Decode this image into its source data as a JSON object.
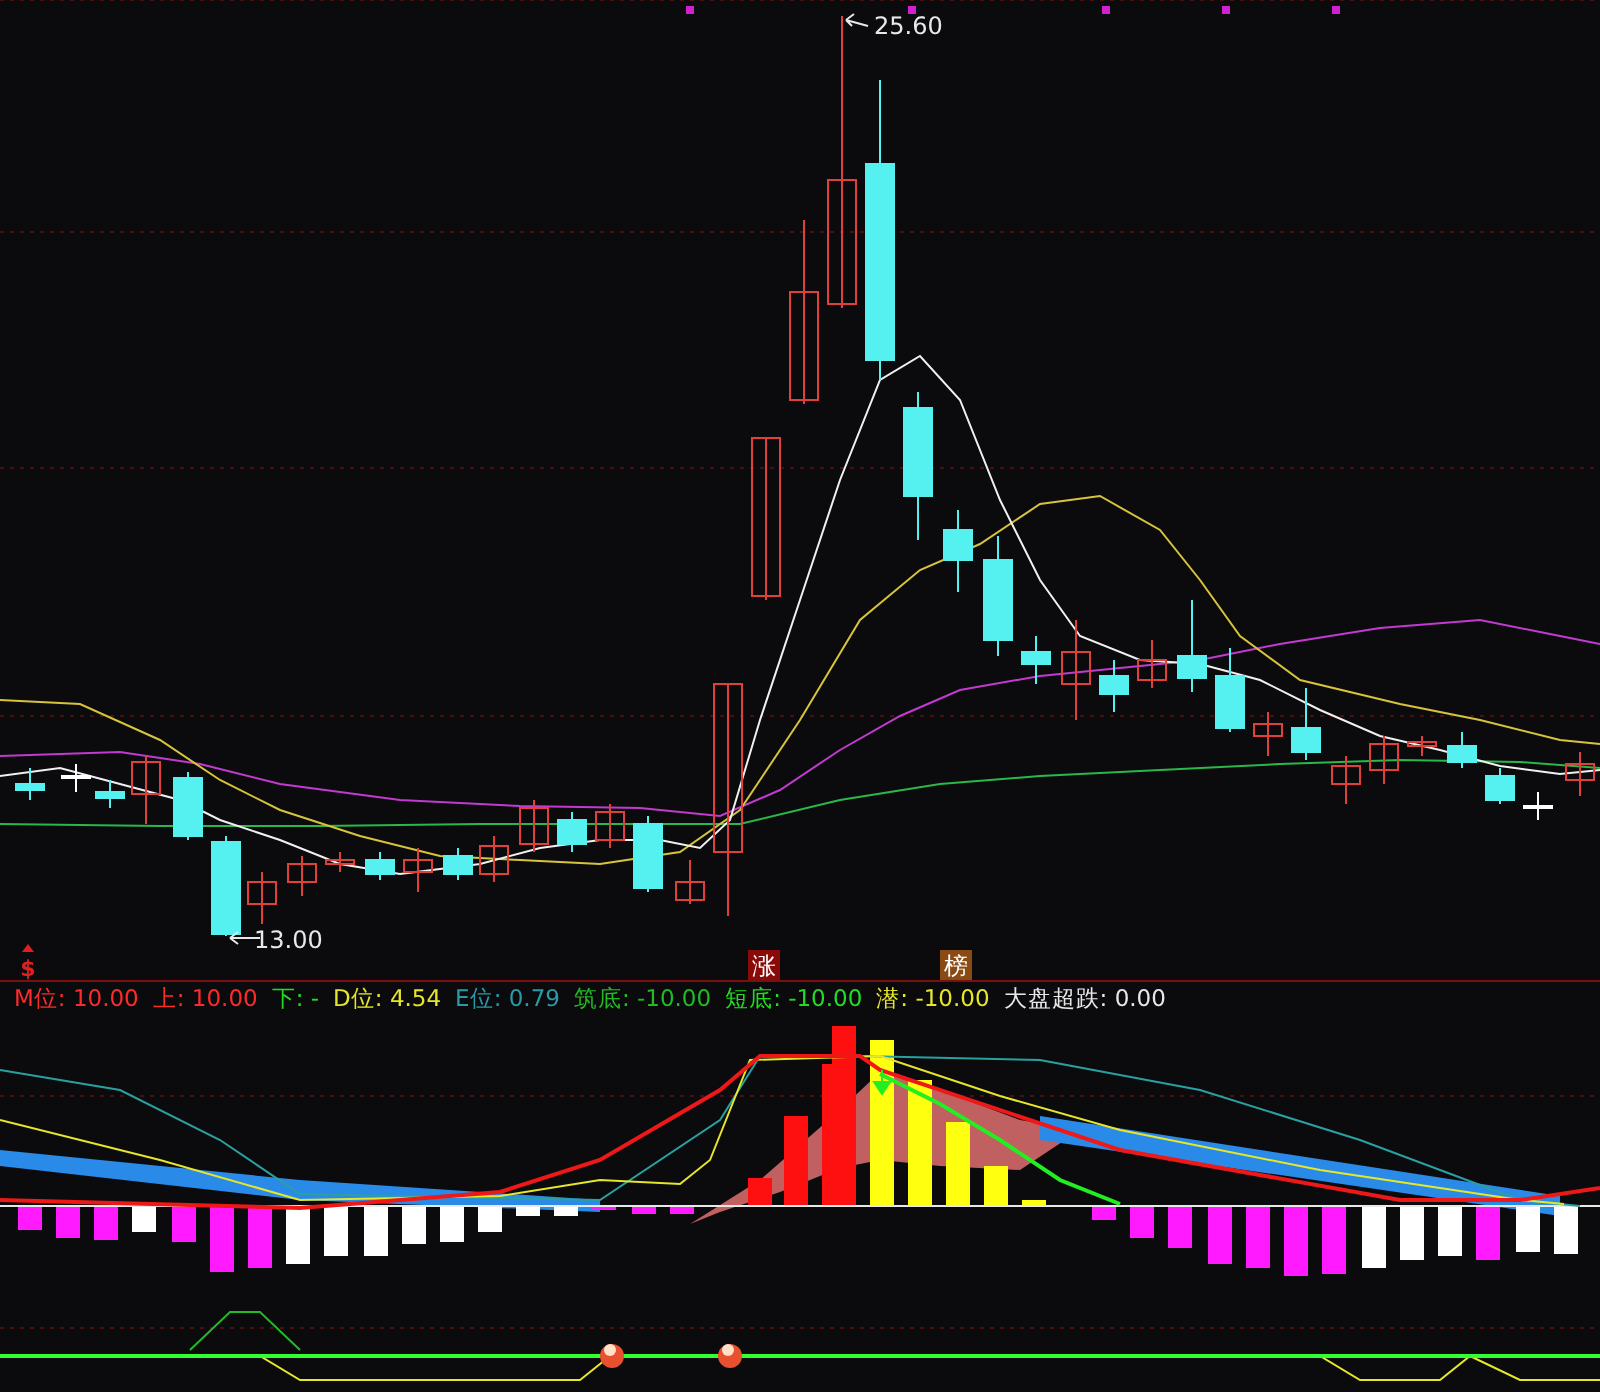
{
  "price_panel": {
    "high_label": "25.60",
    "low_label": "13.00",
    "signals": [
      {
        "text": "$",
        "kind": "marker",
        "color": "#e02020"
      },
      {
        "text": "涨",
        "kind": "badge",
        "color": "#8a0a0a"
      },
      {
        "text": "榜",
        "kind": "badge",
        "color": "#8a4a14"
      }
    ]
  },
  "indicator_legend": [
    {
      "label": "M位:",
      "value": "10.00",
      "color": "#ff2a2a"
    },
    {
      "label": "上:",
      "value": "10.00",
      "color": "#ff2a2a"
    },
    {
      "label": "下:",
      "value": "-",
      "color": "#22dd22"
    },
    {
      "label": "D位:",
      "value": "4.54",
      "color": "#e6e62a"
    },
    {
      "label": "E位:",
      "value": "0.79",
      "color": "#2a9aa8"
    },
    {
      "label": "筑底:",
      "value": "-10.00",
      "color": "#22bb22"
    },
    {
      "label": "短底:",
      "value": "-10.00",
      "color": "#22dd22"
    },
    {
      "label": "潜:",
      "value": "-10.00",
      "color": "#e6e62a"
    },
    {
      "label": "大盘超跌:",
      "value": "0.00",
      "color": "#e8e8e8"
    }
  ]
}
